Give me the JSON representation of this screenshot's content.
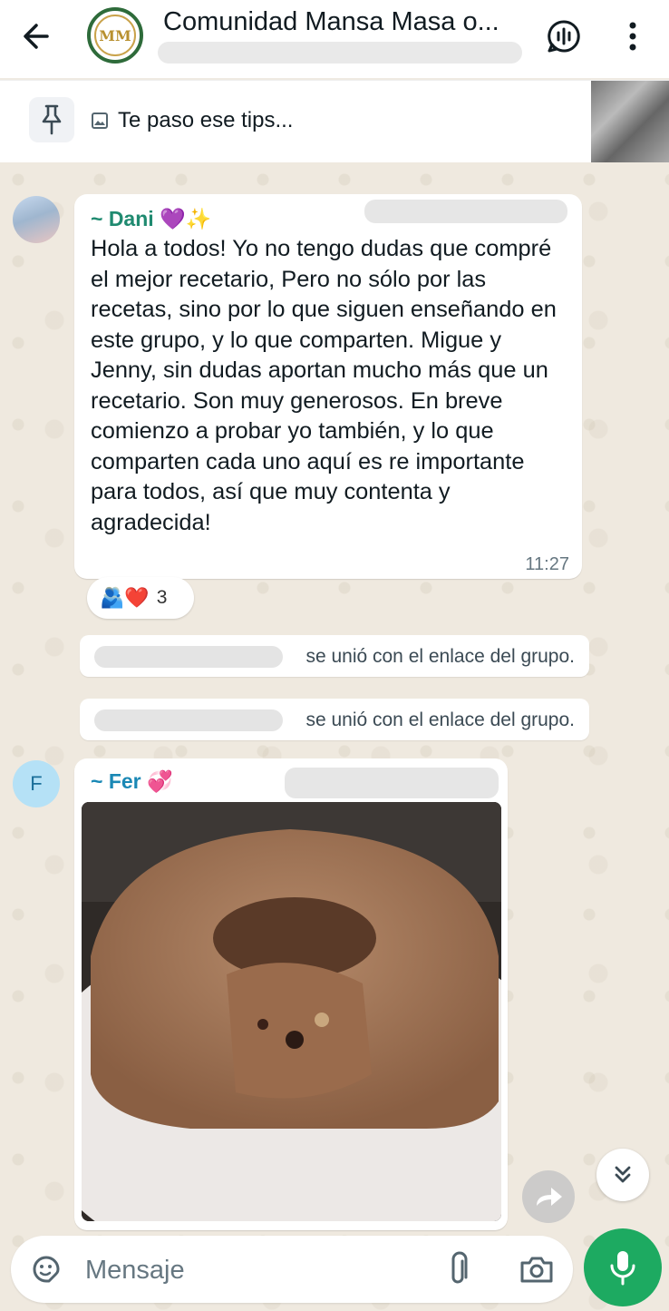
{
  "header": {
    "title": "Comunidad Mansa Masa o...",
    "avatar_text": "MM",
    "icons": {
      "back": "arrow-left-icon",
      "audio": "voice-chat-icon",
      "menu": "more-vert-icon"
    }
  },
  "pinned": {
    "text": "Te paso ese tips...",
    "icons": {
      "pin": "pin-icon",
      "image": "image-icon"
    }
  },
  "messages": [
    {
      "sender": "~ Dani 💜✨",
      "sender_color": "#1f8a70",
      "text": "Hola a todos! Yo no tengo dudas que compré el mejor recetario, Pero no sólo por las recetas, sino por lo que siguen enseñando en este grupo, y lo que comparten. Migue y Jenny, sin dudas aportan mucho más que un recetario. Son muy generosos. En breve comienzo a probar yo también, y lo que comparten cada uno aquí es re importante para todos, así que muy contenta y agradecida!",
      "time": "11:27",
      "reactions": {
        "emojis": "🫂❤️",
        "count": "3"
      }
    },
    {
      "sender": "~ Fer 💞",
      "sender_color": "#1a88b5",
      "avatar_letter": "F"
    }
  ],
  "system_messages": [
    {
      "text": "se unió con el enlace del grupo."
    },
    {
      "text": "se unió con el enlace del grupo."
    }
  ],
  "composer": {
    "placeholder": "Mensaje",
    "icons": {
      "sticker": "sticker-icon",
      "attach": "paperclip-icon",
      "camera": "camera-icon",
      "mic": "mic-icon"
    }
  },
  "colors": {
    "accent_green": "#1daa61",
    "bubble": "#ffffff",
    "wallpaper": "#efe9df"
  }
}
